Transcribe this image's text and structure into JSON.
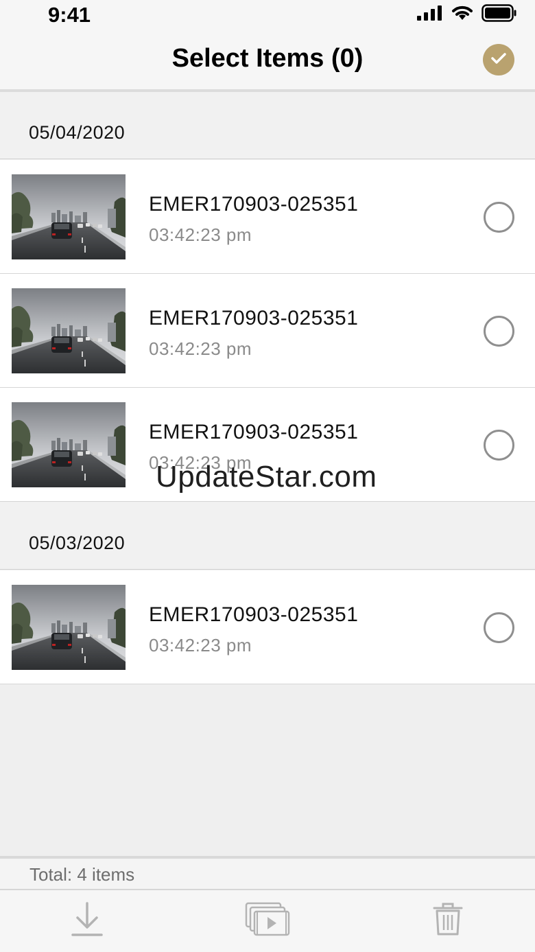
{
  "status_bar": {
    "time": "9:41",
    "icons": [
      "signal-icon",
      "wifi-icon",
      "battery-icon"
    ]
  },
  "header": {
    "title": "Select Items (0)",
    "done_icon": "checkmark-icon",
    "accent_color": "#b9a26f"
  },
  "sections": [
    {
      "date": "05/04/2020",
      "items": [
        {
          "name": "EMER170903-025351",
          "time": "03:42:23 pm",
          "selected": false
        },
        {
          "name": "EMER170903-025351",
          "time": "03:42:23 pm",
          "selected": false
        },
        {
          "name": "EMER170903-025351",
          "time": "03:42:23 pm",
          "selected": false
        }
      ]
    },
    {
      "date": "05/03/2020",
      "items": [
        {
          "name": "EMER170903-025351",
          "time": "03:42:23 pm",
          "selected": false
        }
      ]
    }
  ],
  "watermark": "UpdateStar.com",
  "footer": {
    "total": "Total: 4 items"
  },
  "toolbar": {
    "buttons": [
      "download-icon",
      "video-gallery-icon",
      "trash-icon"
    ]
  }
}
